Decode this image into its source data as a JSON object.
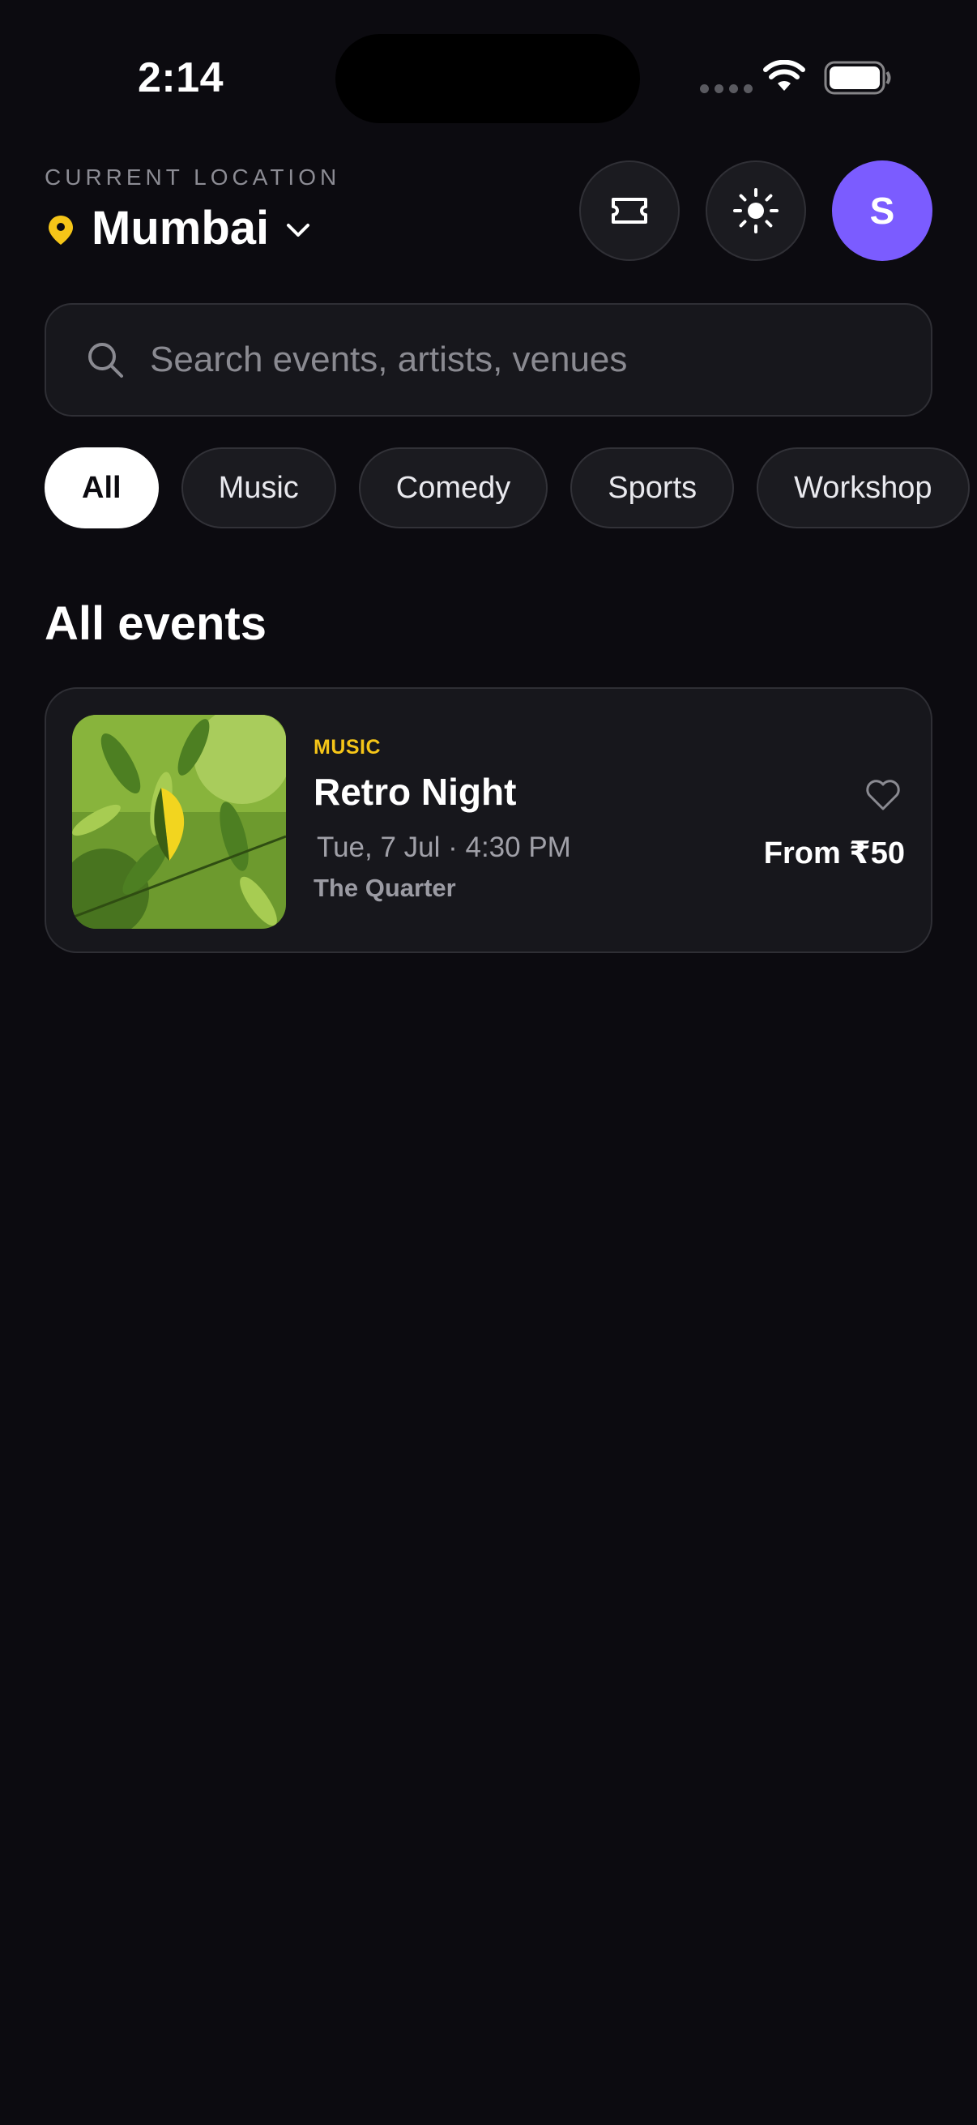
{
  "status_bar": {
    "time": "2:14"
  },
  "header": {
    "location_label": "CURRENT LOCATION",
    "city": "Mumbai",
    "avatar_initial": "S",
    "accent_color": "#7b5cff",
    "pin_color": "#f5c518"
  },
  "search": {
    "placeholder": "Search events, artists, venues",
    "value": ""
  },
  "categories": [
    "All",
    "Music",
    "Comedy",
    "Sports",
    "Workshop"
  ],
  "selected_category": "All",
  "section_title": "All events",
  "events": [
    {
      "category": "MUSIC",
      "title": "Retro Night",
      "date": "Tue, 7 Jul · 4:30 PM",
      "venue": "The Quarter",
      "price": "From ₹50",
      "image": "green-leaves-photo"
    }
  ]
}
